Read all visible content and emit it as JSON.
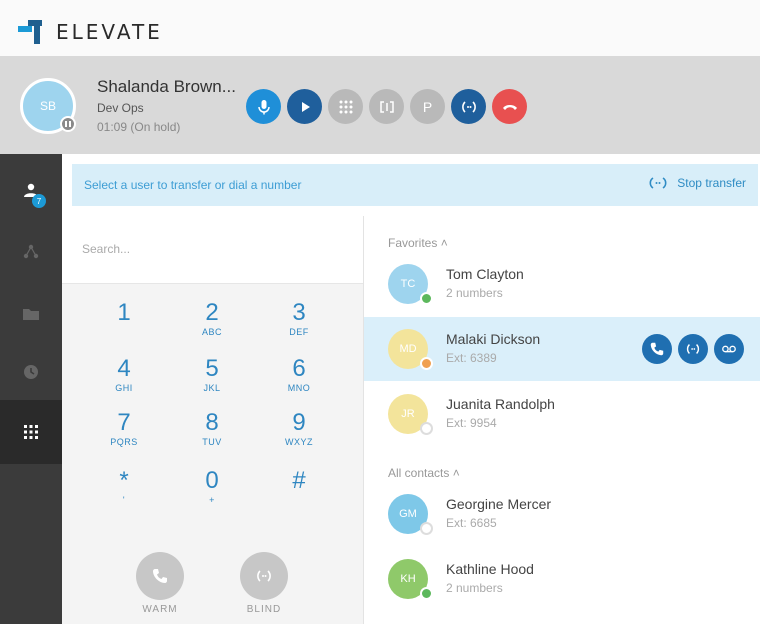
{
  "app": {
    "brand": "ELEVATE"
  },
  "call": {
    "avatar_initials": "SB",
    "caller_name": "Shalanda Brown...",
    "department": "Dev Ops",
    "status_time": "01:09 (On hold)",
    "buttons": [
      {
        "name": "mute-button",
        "icon": "microphone-icon",
        "color": "#1f8fd8"
      },
      {
        "name": "resume-button",
        "icon": "play-icon",
        "color": "#1f5f9c"
      },
      {
        "name": "keypad-button",
        "icon": "keypad-icon",
        "color": "#b9b9b9"
      },
      {
        "name": "merge-button",
        "icon": "merge-icon",
        "color": "#b9b9b9"
      },
      {
        "name": "park-button",
        "icon": "park-icon",
        "label": "P",
        "color": "#b9b9b9"
      },
      {
        "name": "transfer-button",
        "icon": "transfer-icon",
        "color": "#1f5f9c"
      },
      {
        "name": "hangup-button",
        "icon": "hangup-icon",
        "color": "#e85050"
      }
    ]
  },
  "sidebar": {
    "items": [
      {
        "name": "sidebar-item-contacts",
        "icon": "contacts-icon",
        "badge": "7"
      },
      {
        "name": "sidebar-item-network",
        "icon": "network-icon"
      },
      {
        "name": "sidebar-item-files",
        "icon": "folder-icon"
      },
      {
        "name": "sidebar-item-history",
        "icon": "clock-icon"
      },
      {
        "name": "sidebar-item-dialpad",
        "icon": "dialpad-icon",
        "active": true
      }
    ]
  },
  "transfer": {
    "banner_text": "Select a user to transfer or dial a number",
    "stop_label": "Stop transfer"
  },
  "search": {
    "placeholder": "Search..."
  },
  "dialpad": {
    "keys": [
      {
        "digit": "1",
        "letters": ""
      },
      {
        "digit": "2",
        "letters": "ABC"
      },
      {
        "digit": "3",
        "letters": "DEF"
      },
      {
        "digit": "4",
        "letters": "GHI"
      },
      {
        "digit": "5",
        "letters": "JKL"
      },
      {
        "digit": "6",
        "letters": "MNO"
      },
      {
        "digit": "7",
        "letters": "PQRS"
      },
      {
        "digit": "8",
        "letters": "TUV"
      },
      {
        "digit": "9",
        "letters": "WXYZ"
      },
      {
        "digit": "*",
        "letters": "'"
      },
      {
        "digit": "0",
        "letters": "+"
      },
      {
        "digit": "#",
        "letters": ""
      }
    ],
    "warm_label": "WARM",
    "blind_label": "BLIND"
  },
  "contacts": {
    "favorites_label": "Favorites",
    "all_label": "All contacts",
    "favorites": [
      {
        "initials": "TC",
        "name": "Tom Clayton",
        "sub": "2 numbers",
        "avatar_color": "#9ed4ee",
        "status_color": "#5cb85c"
      },
      {
        "initials": "MD",
        "name": "Malaki Dickson",
        "sub": "Ext: 6389",
        "avatar_color": "#f3e49b",
        "status_color": "#f0a050",
        "highlighted": true
      },
      {
        "initials": "JR",
        "name": "Juanita Randolph",
        "sub": "Ext: 9954",
        "avatar_color": "#f3e49b",
        "status_color": "#ffffff"
      }
    ],
    "all": [
      {
        "initials": "GM",
        "name": "Georgine Mercer",
        "sub": "Ext: 6685",
        "avatar_color": "#7ec8e8",
        "status_color": "#ffffff"
      },
      {
        "initials": "KH",
        "name": "Kathline Hood",
        "sub": "2 numbers",
        "avatar_color": "#8fc96a",
        "status_color": "#5cb85c"
      }
    ],
    "row_actions": [
      {
        "name": "call-button",
        "icon": "phone-icon"
      },
      {
        "name": "transfer-contact-button",
        "icon": "transfer-icon"
      },
      {
        "name": "voicemail-button",
        "icon": "voicemail-icon"
      }
    ]
  }
}
